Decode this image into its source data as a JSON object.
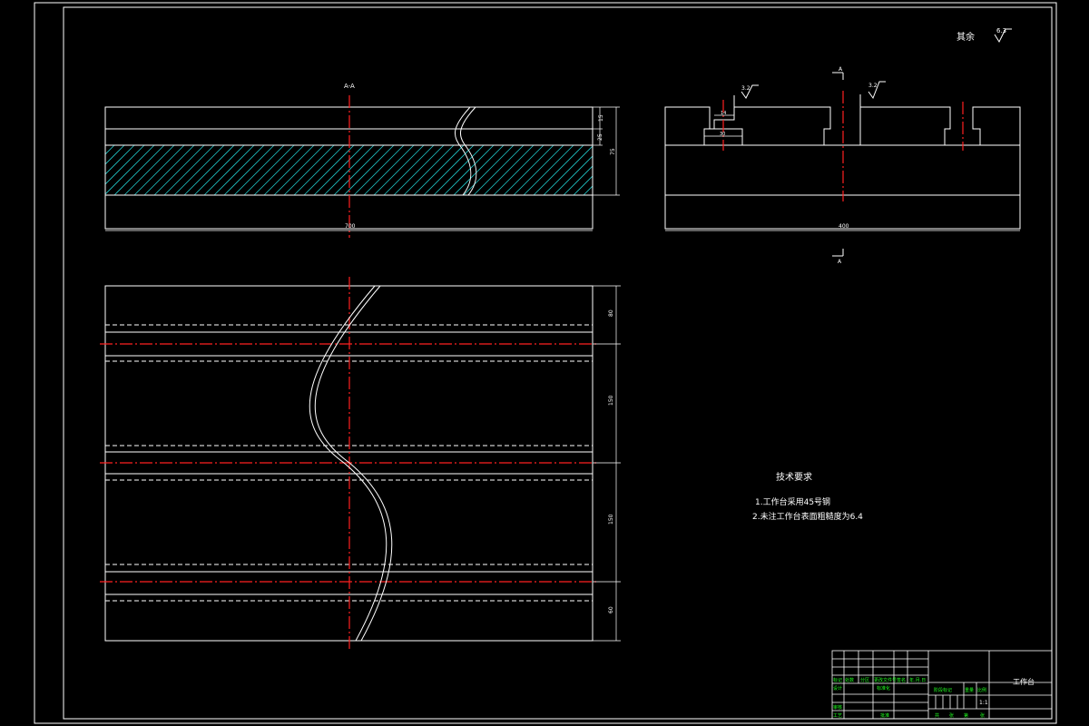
{
  "roughness": {
    "other_label": "其余",
    "other_value": "6.3",
    "value_a": "3.2",
    "value_b": "3.2"
  },
  "section": {
    "letter_top": "A",
    "letter_bottom": "A",
    "label": "A-A"
  },
  "dimensions": {
    "front_h1": "15",
    "front_h2": "25",
    "front_h3": "75",
    "front_width": "700",
    "side_width": "400",
    "side_slot_top": "14",
    "side_slot_bottom": "30",
    "plan_1": "80",
    "plan_2": "150",
    "plan_3": "150",
    "plan_4": "60"
  },
  "tech_notes": {
    "title": "技术要求",
    "items": [
      "1.工作台采用45号钢",
      "2.未注工作台表面粗糙度为6.4"
    ]
  },
  "title_block": {
    "part_name": "工作台",
    "scale_label": "1:1",
    "headers": [
      "标记",
      "处数",
      "分区",
      "更改文件号",
      "签名",
      "年.月.日"
    ],
    "row_labels": [
      "设计",
      "标准化",
      "审核",
      "工艺",
      "批准"
    ],
    "stage_labels": [
      "阶段标记",
      "重量",
      "比例"
    ],
    "sheet_labels": [
      "共",
      "张",
      "第",
      "张"
    ]
  }
}
